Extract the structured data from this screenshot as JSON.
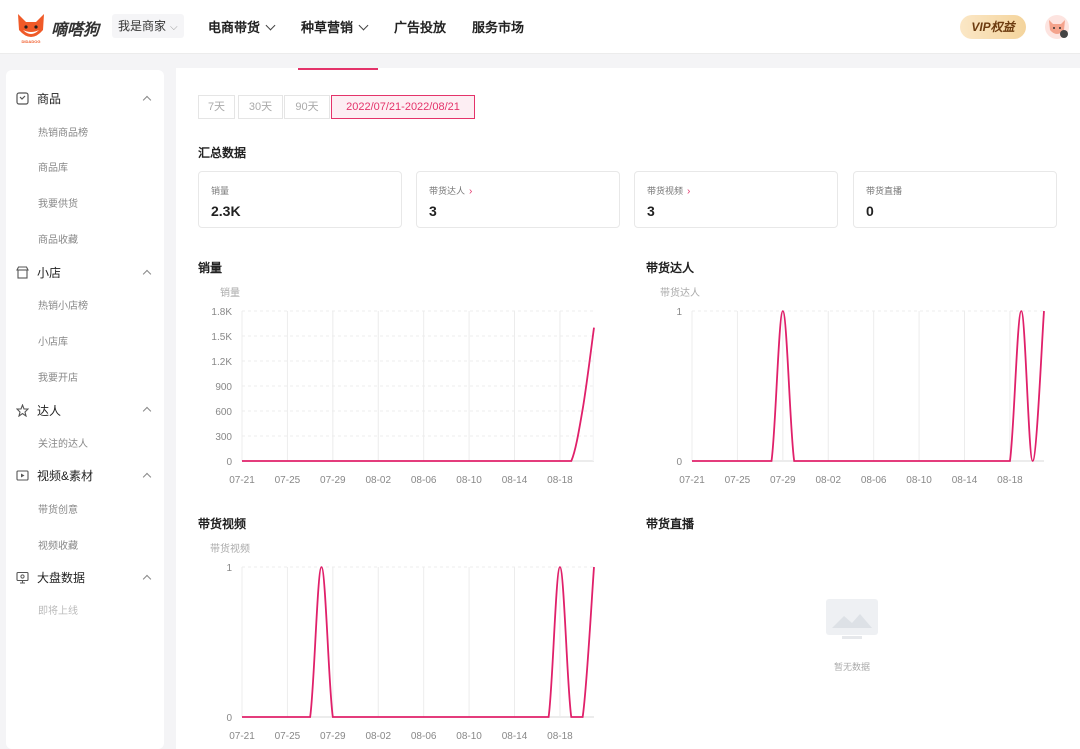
{
  "header": {
    "brand": "嘀嗒狗",
    "logo_text": "DIDADOG",
    "role": "我是商家",
    "nav": [
      "电商带货",
      "种草营销",
      "广告投放",
      "服务市场"
    ],
    "vip": "VIP权益"
  },
  "sidebar": {
    "groups": [
      {
        "label": "商品",
        "icon": "box-icon",
        "items": [
          "热销商品榜",
          "商品库",
          "我要供货",
          "商品收藏"
        ]
      },
      {
        "label": "小店",
        "icon": "store-icon",
        "items": [
          "热销小店榜",
          "小店库",
          "我要开店"
        ]
      },
      {
        "label": "达人",
        "icon": "star-icon",
        "items": [
          "关注的达人"
        ]
      },
      {
        "label": "视频&素材",
        "icon": "video-icon",
        "items": [
          "带货创意",
          "视频收藏"
        ]
      },
      {
        "label": "大盘数据",
        "icon": "monitor-icon",
        "items": [
          "即将上线"
        ]
      }
    ]
  },
  "ranges": [
    "7天",
    "30天",
    "90天",
    "2022/07/21-2022/08/21"
  ],
  "summary": {
    "title": "汇总数据",
    "cards": [
      {
        "label": "销量",
        "value": "2.3K",
        "link": false
      },
      {
        "label": "带货达人",
        "value": "3",
        "link": true
      },
      {
        "label": "带货视频",
        "value": "3",
        "link": true
      },
      {
        "label": "带货直播",
        "value": "0",
        "link": false
      }
    ]
  },
  "panels": {
    "sales": "销量",
    "creators": "带货达人",
    "videos": "带货视频",
    "live": "带货直播",
    "empty": "暂无数据"
  },
  "colors": {
    "accent": "#e4336a",
    "line": "#e0206a"
  },
  "chart_data": [
    {
      "type": "line",
      "title": "销量",
      "ylabel": "销量",
      "x_ticks": [
        "07-21",
        "07-25",
        "07-29",
        "08-02",
        "08-06",
        "08-10",
        "08-14",
        "08-18"
      ],
      "y_ticks": [
        "0",
        "300",
        "600",
        "900",
        "1.2K",
        "1.5K",
        "1.8K"
      ],
      "ylim": [
        0,
        1800
      ],
      "x": [
        "07-21",
        "07-22",
        "07-23",
        "07-24",
        "07-25",
        "07-26",
        "07-27",
        "07-28",
        "07-29",
        "07-30",
        "07-31",
        "08-01",
        "08-02",
        "08-03",
        "08-04",
        "08-05",
        "08-06",
        "08-07",
        "08-08",
        "08-09",
        "08-10",
        "08-11",
        "08-12",
        "08-13",
        "08-14",
        "08-15",
        "08-16",
        "08-17",
        "08-18",
        "08-19",
        "08-20",
        "08-21"
      ],
      "series": [
        {
          "values": [
            0,
            0,
            0,
            0,
            0,
            0,
            0,
            0,
            0,
            0,
            0,
            0,
            0,
            0,
            0,
            0,
            0,
            0,
            0,
            0,
            0,
            0,
            0,
            0,
            0,
            0,
            0,
            0,
            0,
            0,
            620,
            1600
          ]
        }
      ],
      "shade_last_segment": true
    },
    {
      "type": "line",
      "title": "带货达人",
      "ylabel": "带货达人",
      "x_ticks": [
        "07-21",
        "07-25",
        "07-29",
        "08-02",
        "08-06",
        "08-10",
        "08-14",
        "08-18"
      ],
      "y_ticks": [
        "0",
        "1"
      ],
      "ylim": [
        0,
        1
      ],
      "x": [
        "07-21",
        "07-22",
        "07-23",
        "07-24",
        "07-25",
        "07-26",
        "07-27",
        "07-28",
        "07-29",
        "07-30",
        "07-31",
        "08-01",
        "08-02",
        "08-03",
        "08-04",
        "08-05",
        "08-06",
        "08-07",
        "08-08",
        "08-09",
        "08-10",
        "08-11",
        "08-12",
        "08-13",
        "08-14",
        "08-15",
        "08-16",
        "08-17",
        "08-18",
        "08-19",
        "08-20",
        "08-21"
      ],
      "series": [
        {
          "values": [
            0,
            0,
            0,
            0,
            0,
            0,
            0,
            0,
            1,
            0,
            0,
            0,
            0,
            0,
            0,
            0,
            0,
            0,
            0,
            0,
            0,
            0,
            0,
            0,
            0,
            0,
            0,
            0,
            0,
            1,
            0,
            1
          ]
        }
      ]
    },
    {
      "type": "line",
      "title": "带货视频",
      "ylabel": "带货视频",
      "x_ticks": [
        "07-21",
        "07-25",
        "07-29",
        "08-02",
        "08-06",
        "08-10",
        "08-14",
        "08-18"
      ],
      "y_ticks": [
        "0",
        "1"
      ],
      "ylim": [
        0,
        1
      ],
      "x": [
        "07-21",
        "07-22",
        "07-23",
        "07-24",
        "07-25",
        "07-26",
        "07-27",
        "07-28",
        "07-29",
        "07-30",
        "07-31",
        "08-01",
        "08-02",
        "08-03",
        "08-04",
        "08-05",
        "08-06",
        "08-07",
        "08-08",
        "08-09",
        "08-10",
        "08-11",
        "08-12",
        "08-13",
        "08-14",
        "08-15",
        "08-16",
        "08-17",
        "08-18",
        "08-19",
        "08-20",
        "08-21"
      ],
      "series": [
        {
          "values": [
            0,
            0,
            0,
            0,
            0,
            0,
            0,
            1,
            0,
            0,
            0,
            0,
            0,
            0,
            0,
            0,
            0,
            0,
            0,
            0,
            0,
            0,
            0,
            0,
            0,
            0,
            0,
            0,
            1,
            0,
            0,
            1
          ]
        }
      ]
    }
  ]
}
